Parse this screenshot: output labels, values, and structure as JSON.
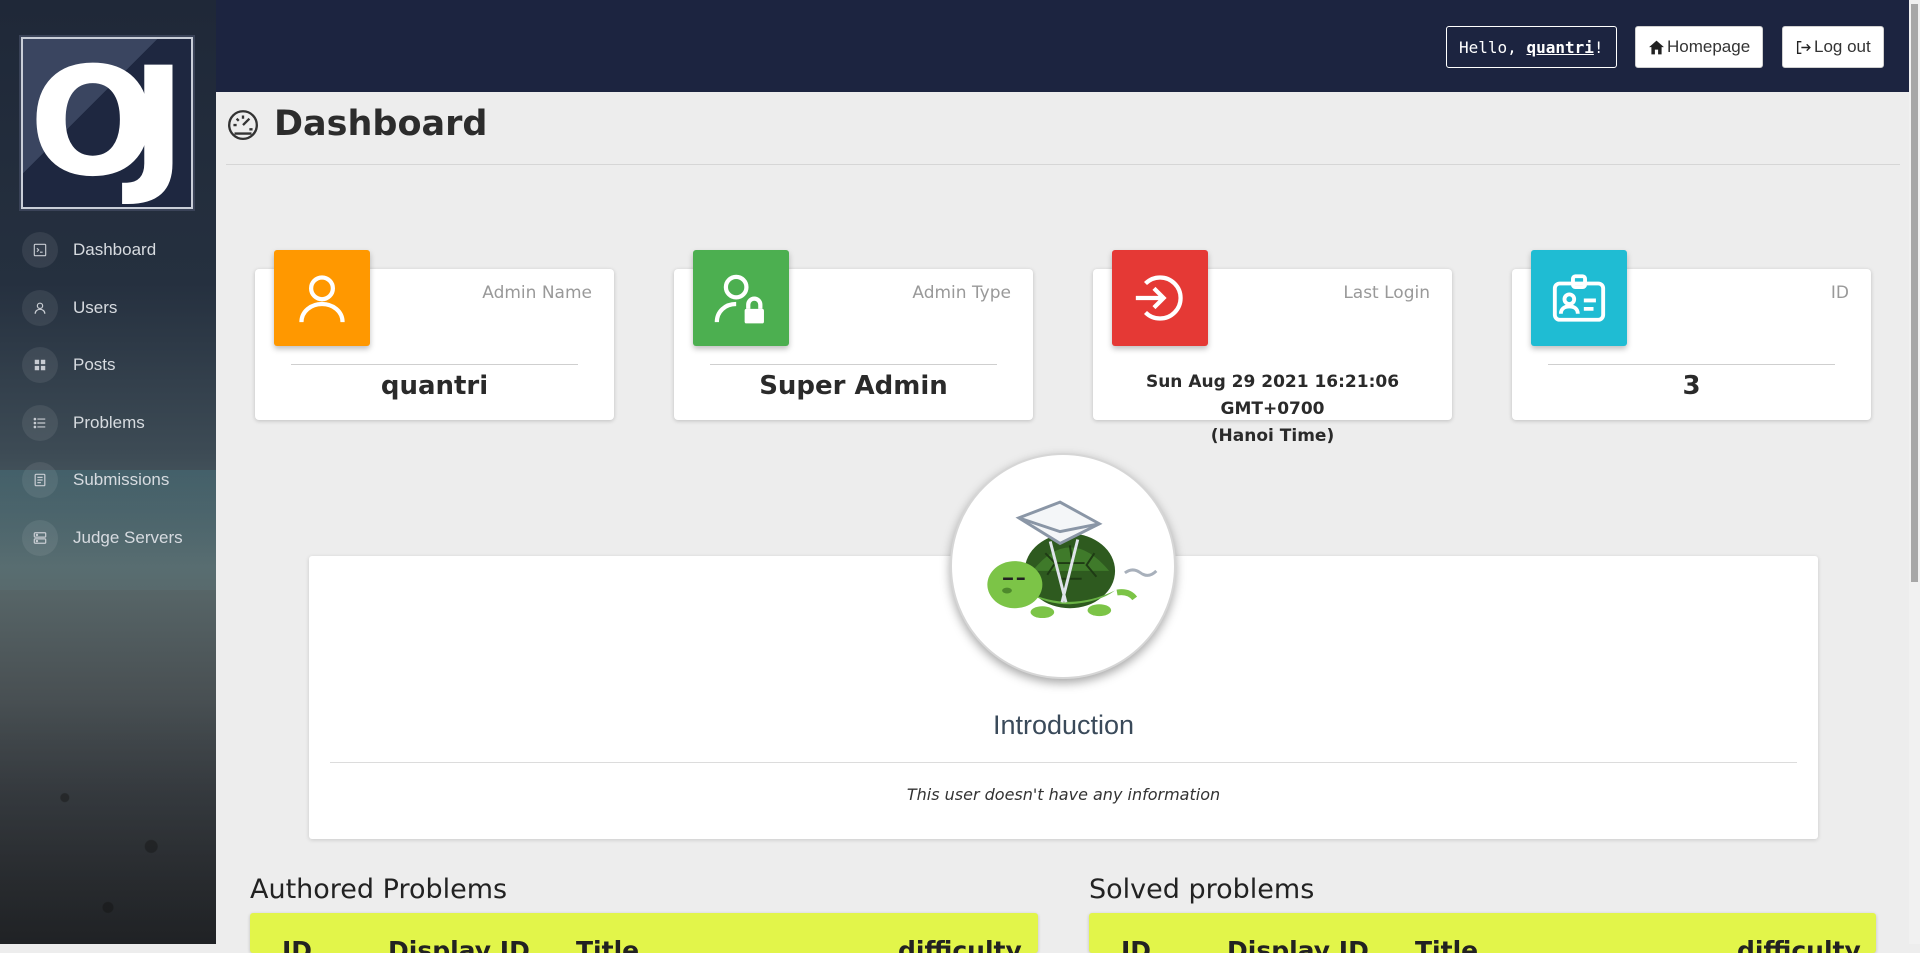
{
  "sidebar": {
    "logo_text": "OJ",
    "items": [
      {
        "label": "Dashboard",
        "icon": "terminal-icon"
      },
      {
        "label": "Users",
        "icon": "user-icon"
      },
      {
        "label": "Posts",
        "icon": "grid-icon"
      },
      {
        "label": "Problems",
        "icon": "list-icon"
      },
      {
        "label": "Submissions",
        "icon": "document-icon"
      },
      {
        "label": "Judge Servers",
        "icon": "server-icon"
      }
    ]
  },
  "topbar": {
    "hello_prefix": "Hello, ",
    "username": "quantri",
    "hello_suffix": "!",
    "homepage_label": "Homepage",
    "logout_label": "Log out"
  },
  "page": {
    "title": "Dashboard"
  },
  "cards": [
    {
      "label": "Admin Name",
      "value": "quantri",
      "color": "#ff9800",
      "icon": "user-icon"
    },
    {
      "label": "Admin Type",
      "value": "Super Admin",
      "color": "#4caf50",
      "icon": "user-lock-icon"
    },
    {
      "label": "Last Login",
      "value_line1": "Sun Aug 29 2021 16:21:06 GMT+0700",
      "value_line2": "(Hanoi Time)",
      "color": "#e53935",
      "icon": "login-icon"
    },
    {
      "label": "ID",
      "value": "3",
      "color": "#1fbcd3",
      "icon": "id-card-icon"
    }
  ],
  "intro": {
    "title": "Introduction",
    "text": "This user doesn't have any information"
  },
  "authored": {
    "title": "Authored Problems",
    "headers": [
      "ID",
      "Display ID",
      "Title",
      "difficulty"
    ]
  },
  "solved": {
    "title": "Solved problems",
    "headers": [
      "ID",
      "Display ID",
      "Title",
      "difficulty"
    ]
  }
}
